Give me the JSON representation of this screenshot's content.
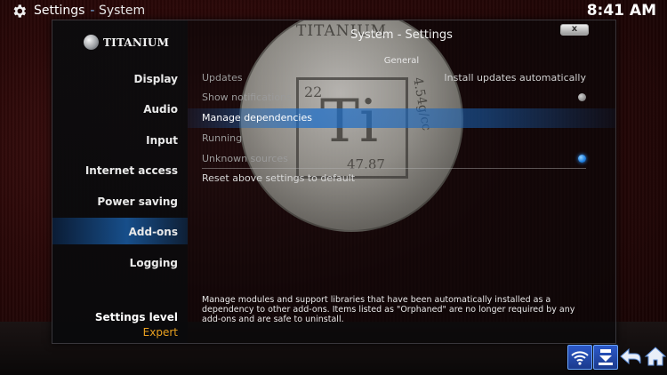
{
  "topbar": {
    "title": "Settings",
    "separator": "-",
    "subtitle": "System",
    "clock": "8:41 AM"
  },
  "dialog": {
    "title": "System - Settings",
    "close_symbol": "x",
    "section": "General",
    "logo_text": "TITANIUM"
  },
  "sidebar": {
    "items": [
      {
        "label": "Display"
      },
      {
        "label": "Audio"
      },
      {
        "label": "Input"
      },
      {
        "label": "Internet access"
      },
      {
        "label": "Power saving"
      },
      {
        "label": "Add-ons"
      },
      {
        "label": "Logging"
      }
    ],
    "active_index": 5,
    "settings_level_label": "Settings level",
    "settings_level_value": "Expert"
  },
  "settings": [
    {
      "label": "Updates",
      "value": "Install updates automatically",
      "style": "dim"
    },
    {
      "label": "Show notifications",
      "style": "dim",
      "toggle": "off"
    },
    {
      "label": "Manage dependencies",
      "style": "bright",
      "selected": true
    },
    {
      "label": "Running",
      "style": "dim"
    },
    {
      "label": "Unknown sources",
      "style": "dim",
      "toggle": "on"
    },
    {
      "label": "Reset above settings to default",
      "style": "normal"
    }
  ],
  "description": "Manage modules and support libraries that have been automatically installed as a dependency to other add-ons. Items listed as \"Orphaned\" are no longer required by any add-ons and are safe to uninstall.",
  "coin": {
    "top_text": "TITANIUM",
    "symbol": "Ti",
    "atomic_number": "22",
    "mass": "47.87",
    "density": "4.54g/cc"
  },
  "colors": {
    "accent": "#1f7fe0",
    "settings_level": "#e8a020",
    "background": "#2a0808"
  },
  "icons": {
    "topbar": "gear-icon",
    "buttons": [
      "wifi-icon",
      "update-icon",
      "back-icon",
      "home-icon"
    ]
  }
}
